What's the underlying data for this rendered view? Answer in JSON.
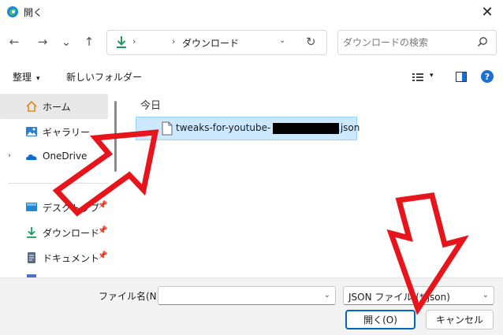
{
  "window": {
    "title": "開く",
    "close_glyph": "✕"
  },
  "nav": {
    "back_glyph": "←",
    "forward_glyph": "→",
    "recent_glyph": "⌄",
    "up_glyph": "↑",
    "address_chevron": "›",
    "breadcrumb": "ダウンロード",
    "address_dropdown_glyph": "⌄",
    "refresh_glyph": "↻",
    "search_placeholder": "ダウンロードの検索"
  },
  "commandbar": {
    "organize_label": "整理",
    "organize_dropdown": "▾",
    "new_folder_label": "新しいフォルダー",
    "view_dropdown": "▾",
    "help_glyph": "?"
  },
  "sidebar": {
    "items": [
      {
        "label": "ホーム",
        "icon": "home-icon",
        "selected": true
      },
      {
        "label": "ギャラリー",
        "icon": "gallery-icon"
      },
      {
        "label": "OneDrive",
        "icon": "onedrive-icon",
        "expander": "›"
      },
      {
        "label": "デスクトップ",
        "icon": "desktop-icon",
        "pin": "📌"
      },
      {
        "label": "ダウンロード",
        "icon": "download-icon",
        "pin": "📌"
      },
      {
        "label": "ドキュメント",
        "icon": "document-icon",
        "pin": "📌"
      }
    ]
  },
  "files": {
    "group_header": "今日",
    "items": [
      {
        "name_visible_prefix": "tweaks-for-youtube-",
        "name_visible_suffix": ".json",
        "icon": "file-icon",
        "selected": true
      }
    ]
  },
  "bottom": {
    "filename_label": "ファイル名(N):",
    "filename_value": "",
    "filetype_value": "JSON ファイル (*.json)",
    "open_label": "開く(O)",
    "cancel_label": "キャンセル",
    "dropdown_glyph": "⌄"
  },
  "colors": {
    "accent": "#0067c0",
    "selection_bg": "#cce8ff",
    "annotation_red": "#e8141c"
  }
}
